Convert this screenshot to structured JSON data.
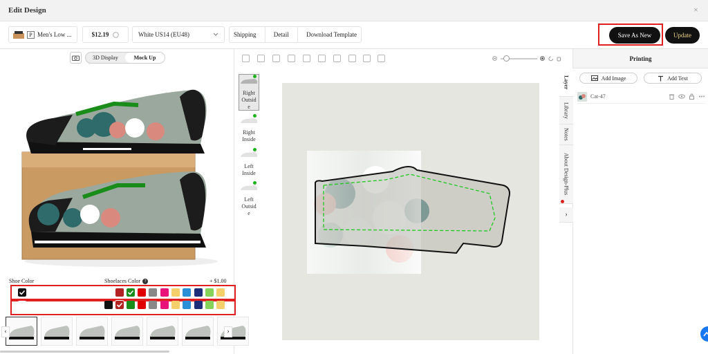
{
  "window": {
    "title": "Edit Design",
    "close": "×"
  },
  "product": {
    "badge": "P",
    "name": "Men's Low ...",
    "price": "$12.19",
    "size": "White US14 (EU48)"
  },
  "tabs": [
    "Shipping",
    "Detail",
    "Download Template"
  ],
  "actions": {
    "save_as_new": "Save As New",
    "update": "Update"
  },
  "preview": {
    "modes": [
      "3D Display",
      "Mock Up"
    ],
    "active_mode": "Mock Up"
  },
  "views": [
    {
      "label": "Right Outside",
      "lines": [
        "Right",
        "Outsid",
        "e"
      ],
      "selected": true
    },
    {
      "label": "Right Inside",
      "lines": [
        "Right",
        "Inside"
      ]
    },
    {
      "label": "Left Inside",
      "lines": [
        "Left",
        "Inside"
      ]
    },
    {
      "label": "Left Outside",
      "lines": [
        "Left",
        "Outsid",
        "e"
      ]
    }
  ],
  "colors": {
    "shoe_label": "Shoe Color",
    "laces_label": "Shoelaces Color",
    "laces_price": "+ $1.00",
    "row1": [
      "#111111",
      "#ffffff",
      "#b22222",
      "#1a8c1a",
      "#e00000",
      "#888888",
      "#e8127a",
      "#f5cf6b",
      "#2a8fd6",
      "#1e2f7a",
      "#85d35a",
      "#f5cf6b"
    ],
    "row2": [
      "#ffffff",
      "#111111",
      "#b22222",
      "#1a8c1a",
      "#e00000",
      "#888888",
      "#e8127a",
      "#f5cf6b",
      "#2a8fd6",
      "#1e2f7a",
      "#85d35a",
      "#f5cf6b"
    ]
  },
  "right_panel": {
    "title": "Printing",
    "add_image": "Add Image",
    "add_text": "Add Text",
    "layer_name": "Cat-47",
    "side_tabs": [
      "Layer",
      "Library",
      "Notes",
      "About Design-Plus"
    ]
  },
  "thumbs_count": 7
}
